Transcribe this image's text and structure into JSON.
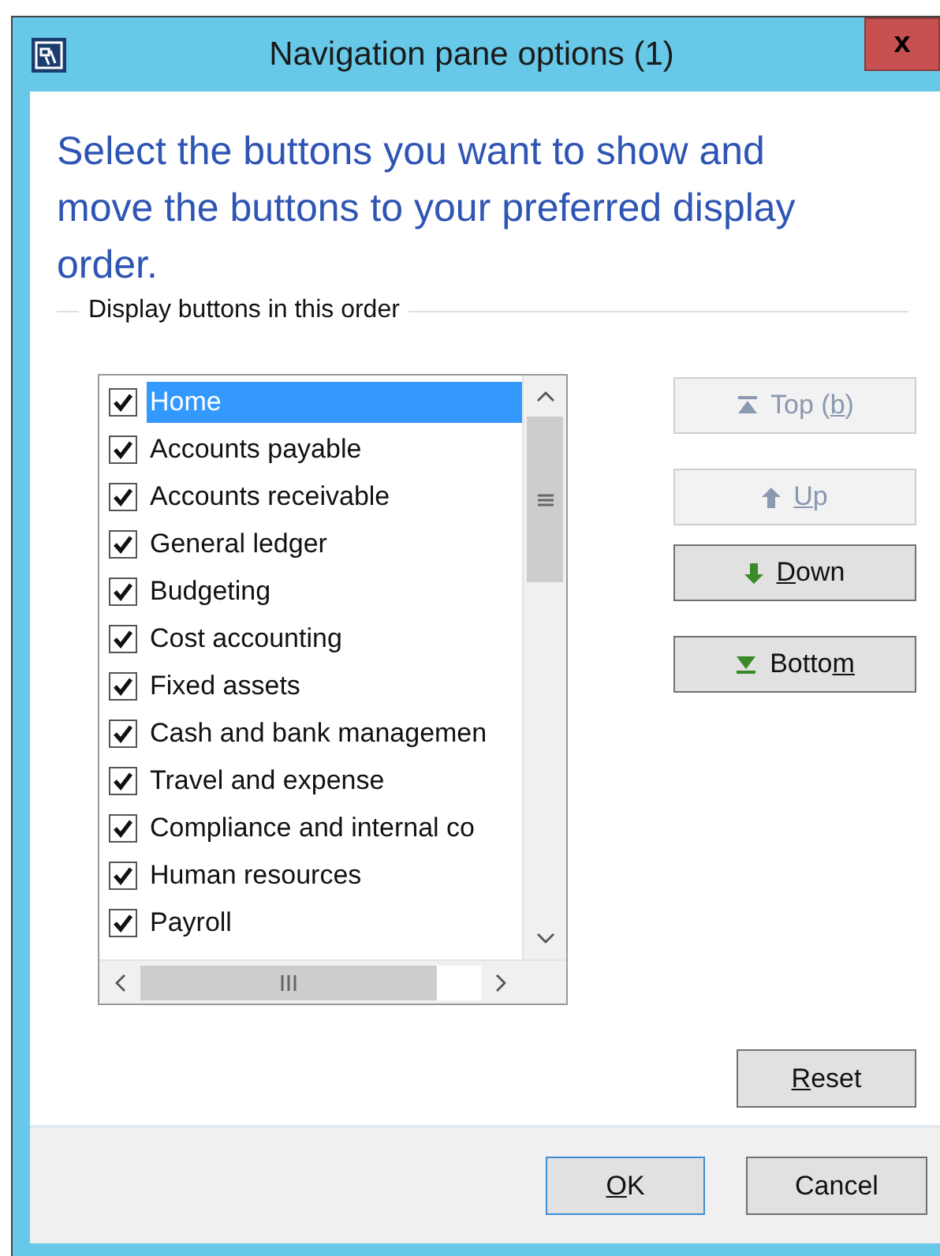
{
  "window": {
    "title": "Navigation pane options (1)",
    "close": "x"
  },
  "instruction": "Select the buttons you want to show and move the buttons to your preferred display order.",
  "group": {
    "label": "Display buttons in this order"
  },
  "items": [
    {
      "label": "Home",
      "checked": true,
      "selected": true
    },
    {
      "label": "Accounts payable",
      "checked": true,
      "selected": false
    },
    {
      "label": "Accounts receivable",
      "checked": true,
      "selected": false
    },
    {
      "label": "General ledger",
      "checked": true,
      "selected": false
    },
    {
      "label": "Budgeting",
      "checked": true,
      "selected": false
    },
    {
      "label": "Cost accounting",
      "checked": true,
      "selected": false
    },
    {
      "label": "Fixed assets",
      "checked": true,
      "selected": false
    },
    {
      "label": "Cash and bank managemen",
      "checked": true,
      "selected": false
    },
    {
      "label": "Travel and expense",
      "checked": true,
      "selected": false
    },
    {
      "label": "Compliance and internal co",
      "checked": true,
      "selected": false
    },
    {
      "label": "Human resources",
      "checked": true,
      "selected": false
    },
    {
      "label": "Payroll",
      "checked": true,
      "selected": false
    }
  ],
  "move_buttons": [
    {
      "kind": "top",
      "before": "Top (",
      "key": "b",
      "after": ")",
      "disabled": true
    },
    {
      "kind": "up",
      "key": "U",
      "after": "p",
      "disabled": true
    },
    {
      "kind": "down",
      "key": "D",
      "after": "own",
      "disabled": false
    },
    {
      "kind": "bottom",
      "before": "Botto",
      "key": "m",
      "disabled": false
    }
  ],
  "reset_button": {
    "key": "R",
    "after": "eset"
  },
  "footer_buttons": [
    {
      "key": "O",
      "after": "K",
      "default": true
    },
    {
      "before": "Cancel",
      "default": false
    }
  ]
}
